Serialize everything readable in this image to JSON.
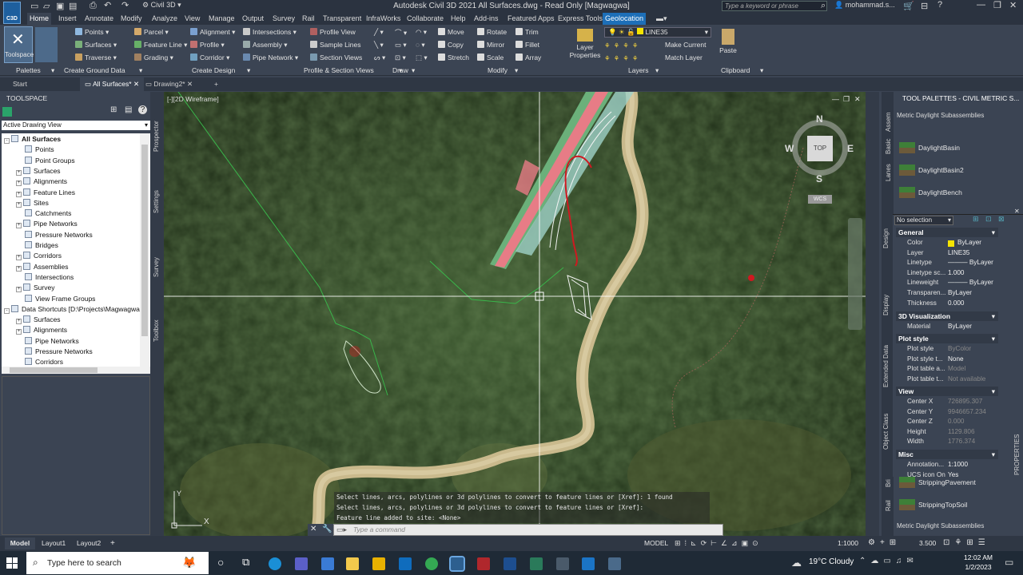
{
  "titlebar": {
    "app_logo": "C3D",
    "workspace": "Civil 3D",
    "title": "Autodesk Civil 3D 2021    All Surfaces.dwg - Read Only [Magwagwa]",
    "search_placeholder": "Type a keyword or phrase",
    "user": "mohammad.s..."
  },
  "menu": [
    "Home",
    "Insert",
    "Annotate",
    "Modify",
    "Analyze",
    "View",
    "Manage",
    "Output",
    "Survey",
    "Rail",
    "Transparent",
    "InfraWorks",
    "Collaborate",
    "Help",
    "Add-ins",
    "Featured Apps",
    "Express Tools",
    "Geolocation"
  ],
  "ribbon": {
    "toolspace": "Toolspace",
    "create_ground": [
      "Points",
      "Surfaces",
      "Traverse",
      "Parcel",
      "Feature Line",
      "Grading"
    ],
    "create_design": [
      "Alignment",
      "Profile",
      "Corridor",
      "Intersections",
      "Assembly",
      "Pipe Network"
    ],
    "profile_section": [
      "Profile View",
      "Sample Lines",
      "Section Views"
    ],
    "modify": [
      "Move",
      "Copy",
      "Stretch",
      "Rotate",
      "Mirror",
      "Scale",
      "Trim",
      "Fillet",
      "Array"
    ],
    "layer_name": "LINE35",
    "layers": [
      "Layer Properties",
      "Make Current",
      "Match Layer"
    ],
    "clipboard": "Paste",
    "panel_titles": [
      "Palettes",
      "Create Ground Data",
      "Create Design",
      "Profile & Section Views",
      "Draw",
      "Modify",
      "Layers",
      "Clipboard"
    ]
  },
  "doc_tabs": [
    "Start",
    "All Surfaces*",
    "Drawing2*"
  ],
  "toolspace": {
    "title": "TOOLSPACE",
    "view": "Active Drawing View",
    "side_tabs": [
      "Prospector",
      "Settings",
      "Survey",
      "Toolbox"
    ],
    "tree": [
      {
        "label": "All Surfaces",
        "indent": 0,
        "bold": true,
        "exp": "-"
      },
      {
        "label": "Points",
        "indent": 1,
        "exp": ""
      },
      {
        "label": "Point Groups",
        "indent": 1,
        "exp": ""
      },
      {
        "label": "Surfaces",
        "indent": 1,
        "exp": "+"
      },
      {
        "label": "Alignments",
        "indent": 1,
        "exp": "+"
      },
      {
        "label": "Feature Lines",
        "indent": 1,
        "exp": "+"
      },
      {
        "label": "Sites",
        "indent": 1,
        "exp": "+"
      },
      {
        "label": "Catchments",
        "indent": 1,
        "exp": ""
      },
      {
        "label": "Pipe Networks",
        "indent": 1,
        "exp": "+"
      },
      {
        "label": "Pressure Networks",
        "indent": 1,
        "exp": ""
      },
      {
        "label": "Bridges",
        "indent": 1,
        "exp": ""
      },
      {
        "label": "Corridors",
        "indent": 1,
        "exp": "+"
      },
      {
        "label": "Assemblies",
        "indent": 1,
        "exp": "+"
      },
      {
        "label": "Intersections",
        "indent": 1,
        "exp": ""
      },
      {
        "label": "Survey",
        "indent": 1,
        "exp": "+"
      },
      {
        "label": "View Frame Groups",
        "indent": 1,
        "exp": ""
      },
      {
        "label": "Data Shortcuts [D:\\Projects\\Magwagwa...",
        "indent": 0,
        "exp": "-"
      },
      {
        "label": "Surfaces",
        "indent": 1,
        "exp": "+"
      },
      {
        "label": "Alignments",
        "indent": 1,
        "exp": "+"
      },
      {
        "label": "Pipe Networks",
        "indent": 1,
        "exp": ""
      },
      {
        "label": "Pressure Networks",
        "indent": 1,
        "exp": ""
      },
      {
        "label": "Corridors",
        "indent": 1,
        "exp": ""
      }
    ]
  },
  "viewport": {
    "label": "[-][2D Wireframe]",
    "viewcube": {
      "top": "TOP",
      "n": "N",
      "s": "S",
      "e": "E",
      "w": "W",
      "wcs": "WCS"
    },
    "command_history": [
      "Select lines, arcs, polylines or 3d polylines to convert to feature lines or [Xref]: 1 found",
      "Select lines, arcs, polylines or 3d polylines to convert to feature lines or [Xref]:",
      "Feature line added to site: <None>"
    ],
    "command_placeholder": "Type a command",
    "ucs_y": "Y",
    "ucs_x": "X"
  },
  "palette": {
    "title": "TOOL PALETTES - CIVIL METRIC S...",
    "group": "Metric Daylight Subassemblies",
    "group_bottom": "Metric Daylight Subassemblies",
    "side_tabs": [
      "Assem",
      "Basic",
      "Lanes",
      "Design",
      "Display",
      "Extended Data",
      "Object Class",
      "Bri",
      "Rail"
    ],
    "items": [
      "DaylightBasin",
      "DaylightBasin2",
      "DaylightBench"
    ],
    "items_bottom": [
      "StrippingPavement",
      "StrippingTopSoil"
    ],
    "selection": "No selection",
    "properties_tab": "PROPERTIES",
    "sections": {
      "general": {
        "title": "General",
        "rows": [
          [
            "Color",
            "ByLayer"
          ],
          [
            "Layer",
            "LINE35"
          ],
          [
            "Linetype",
            "——— ByLayer"
          ],
          [
            "Linetype sc...",
            "1.000"
          ],
          [
            "Lineweight",
            "——— ByLayer"
          ],
          [
            "Transparen...",
            "ByLayer"
          ],
          [
            "Thickness",
            "0.000"
          ]
        ]
      },
      "viz": {
        "title": "3D Visualization",
        "rows": [
          [
            "Material",
            "ByLayer"
          ]
        ]
      },
      "plot": {
        "title": "Plot style",
        "rows": [
          [
            "Plot style",
            "ByColor"
          ],
          [
            "Plot style t...",
            "None"
          ],
          [
            "Plot table a...",
            "Model"
          ],
          [
            "Plot table t...",
            "Not available"
          ]
        ]
      },
      "view": {
        "title": "View",
        "rows": [
          [
            "Center X",
            "726895.307"
          ],
          [
            "Center Y",
            "9946657.234"
          ],
          [
            "Center Z",
            "0.000"
          ],
          [
            "Height",
            "1129.806"
          ],
          [
            "Width",
            "1776.374"
          ]
        ]
      },
      "misc": {
        "title": "Misc",
        "rows": [
          [
            "Annotation...",
            "1:1000"
          ],
          [
            "UCS icon On",
            "Yes"
          ]
        ]
      }
    }
  },
  "statusbar": {
    "tabs": [
      "Model",
      "Layout1",
      "Layout2"
    ],
    "model": "MODEL",
    "scale": "1:1000",
    "zoom": "3.500"
  },
  "taskbar": {
    "search": "Type here to search",
    "weather": "19°C  Cloudy",
    "time": "12:02 AM",
    "date": "1/2/2023"
  },
  "colors": {
    "accent": "#1d6fb8",
    "corridor": "#e77c86",
    "line_green": "#39b54a",
    "red": "#d01820"
  }
}
